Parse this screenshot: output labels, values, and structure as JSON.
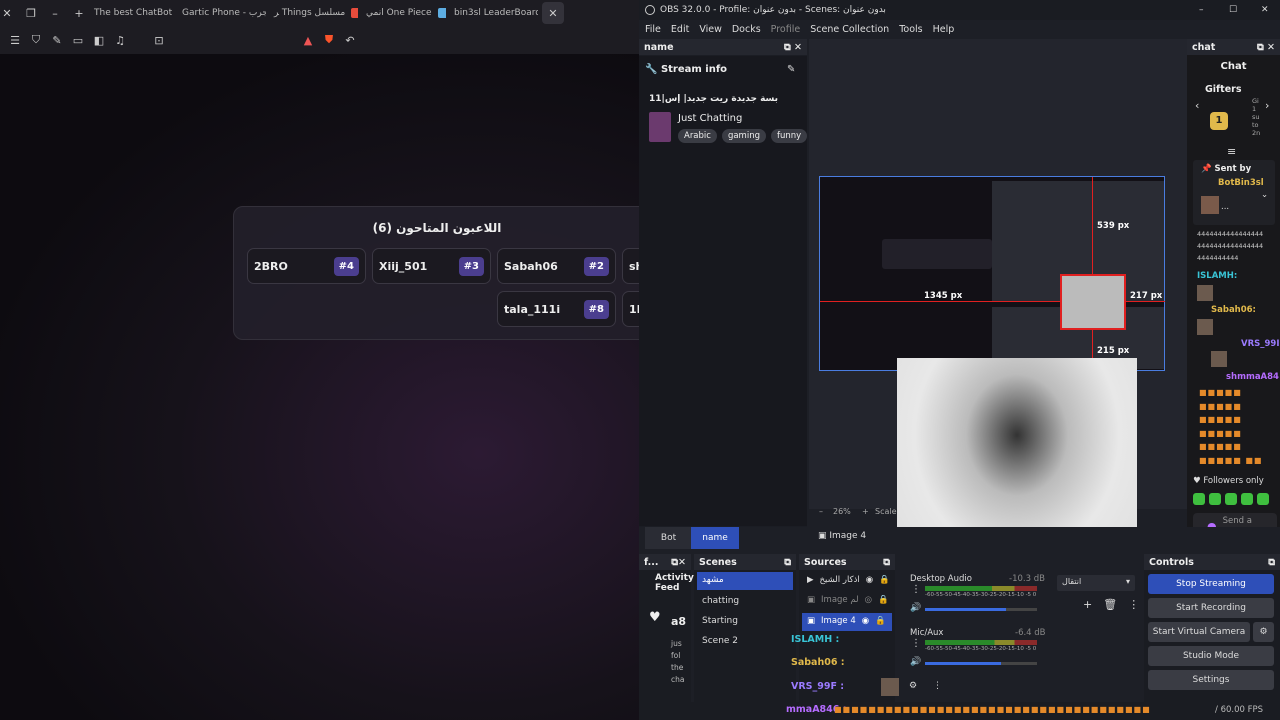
{
  "browser": {
    "tabs": [
      {
        "title": "The best ChatBot",
        "color": "#f5a623"
      },
      {
        "title": "Gartic Phone - جرب",
        "color": "#9b59b6"
      },
      {
        "title": "ﺮ Things مسلسل",
        "color": "#e74c3c"
      },
      {
        "title": "انمي One Piece",
        "color": "#5dade2"
      },
      {
        "title": "bin3sl LeaderBoard",
        "color": "#dddddd"
      }
    ]
  },
  "game": {
    "title": "اللاعبون المتاحون (6)",
    "players_row1": [
      {
        "name": "2BRO",
        "rank": "#4"
      },
      {
        "name": "Xiij_501",
        "rank": "#3"
      },
      {
        "name": "Sabah06",
        "rank": "#2"
      },
      {
        "name": "sh",
        "rank": ""
      }
    ],
    "players_row2": [
      {
        "name": "tala_111i",
        "rank": "#8"
      },
      {
        "name": "1H",
        "rank": ""
      }
    ]
  },
  "obs": {
    "title": "OBS 32.0.0 - Profile: بدون عنوان - Scenes: بدون عنوان",
    "menu": [
      "File",
      "Edit",
      "View",
      "Docks",
      "Profile",
      "Scene Collection",
      "Tools",
      "Help"
    ],
    "name_panel": "name",
    "stream_info": {
      "header": "Stream info",
      "title": "بسة جديدة ريت جديد| إس|11",
      "category": "Just Chatting",
      "tags": [
        "Arabic",
        "gaming",
        "funny"
      ]
    },
    "preview": {
      "width_label": "1345 px",
      "top_label": "539 px",
      "right_label": "217 px",
      "bottom_label": "215 px",
      "zoom": "26%",
      "scale_label": "Scale t"
    },
    "bot_tabs": [
      "Bot",
      "name"
    ],
    "selected_source_label": "Image 4",
    "chat": {
      "header": "chat",
      "title": "Chat",
      "gifters": "Gifters",
      "gifter_rank": "1",
      "gift_text": "Gi 1 su to 2n",
      "sent_by": "Sent by",
      "sent_by_user": "BotBin3sl",
      "sent_by_extra": "...",
      "messages": [
        {
          "text": "4444444444444444"
        },
        {
          "text": "4444444444444444"
        },
        {
          "text": "4444444444"
        },
        {
          "user": "ISLAMH:",
          "color": "#39c4d6"
        },
        {
          "user": "Sabah06:",
          "color": "#e1b94b"
        },
        {
          "user": "VRS_99I",
          "color": "#9b7bff"
        },
        {
          "user": "shmmaA84",
          "color": "#b56cff"
        }
      ],
      "followers": "Followers only",
      "send_placeholder": "Send a message"
    },
    "activity": {
      "header": "f...",
      "label": "Activity Feed",
      "user": "a8",
      "text": "jus fol the cha"
    },
    "scenes": {
      "header": "Scenes",
      "items": [
        "مشهد",
        "chatting",
        "Starting",
        "Scene 2"
      ]
    },
    "sources": {
      "header": "Sources",
      "items": [
        "اذكار الشيخ",
        "Image لم",
        "Image 4"
      ]
    },
    "source_chat": [
      {
        "user": "ISLAMH :"
      },
      {
        "user": "Sabah06 :"
      },
      {
        "user": "VRS_99F :"
      }
    ],
    "mixer": {
      "desktop": {
        "label": "Desktop Audio",
        "db": "-10.3 dB",
        "level": 0.72
      },
      "mic": {
        "label": "Mic/Aux",
        "db": "-6.4 dB",
        "level": 0.68
      },
      "scale": "-60-55-50-45-40-35-30-25-20-15-10 -5 0"
    },
    "transition": {
      "label": "انتقال"
    },
    "controls": {
      "header": "Controls",
      "stop_streaming": "Stop Streaming",
      "start_recording": "Start Recording",
      "start_virtual_camera": "Start Virtual Camera",
      "studio_mode": "Studio Mode",
      "settings": "Settings"
    },
    "status": {
      "ticker_user": "mmaA846 :",
      "fps": "/ 60.00 FPS"
    }
  }
}
